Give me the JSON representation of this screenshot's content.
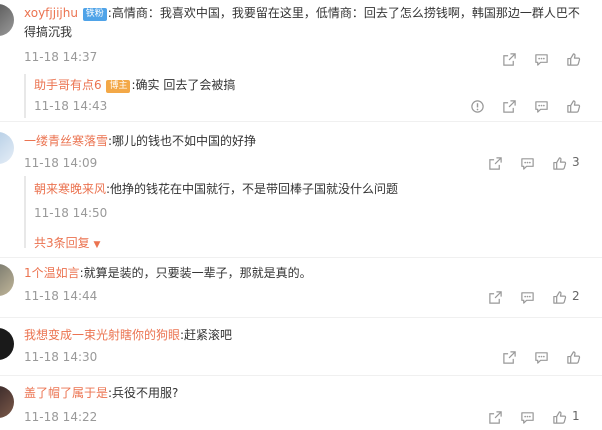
{
  "comments": [
    {
      "user": "xoyfjjijhu",
      "badge": "铁粉",
      "text_line1": ":高情商：我喜欢中国，我要留在这里，低情商：回去了怎么捞钱啊，韩国那边一群人巴不",
      "text_line2": "得搞沉我",
      "time": "11-18 14:37",
      "likes": "",
      "replies": [
        {
          "user": "助手哥有点6",
          "badge": "博主",
          "text": ":确实 回去了会被搞",
          "time": "11-18 14:43"
        }
      ]
    },
    {
      "user": "一缕青丝寒落雪",
      "text": ":哪儿的钱也不如中国的好挣",
      "time": "11-18 14:09",
      "likes": "3",
      "replies": [
        {
          "user": "朝来寒晚来风",
          "text": ":他挣的钱花在中国就行，不是带回棒子国就没什么问题",
          "time": "11-18 14:50"
        }
      ],
      "more_replies": "共3条回复"
    },
    {
      "user": "1个温如言",
      "text": ":就算是装的，只要装一辈子，那就是真的。",
      "time": "11-18 14:44",
      "likes": "2"
    },
    {
      "user": "我想变成一束光射瞎你的狗眼",
      "text": ":赶紧滚吧",
      "time": "11-18 14:30",
      "likes": ""
    },
    {
      "user": "盖了帽了属于是",
      "text": ":兵役不用服?",
      "time": "11-18 14:22",
      "likes": "1"
    }
  ],
  "icons": [
    "share-icon",
    "comment-icon",
    "like-icon",
    "report-icon"
  ],
  "colors": {
    "username": "#eb7350",
    "time": "#999999",
    "badge_fan": "#4fa3e8",
    "badge_host": "#f3a847"
  }
}
